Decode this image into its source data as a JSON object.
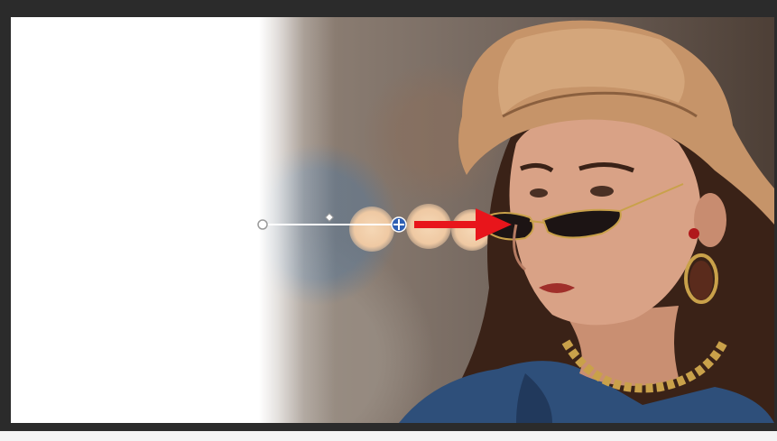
{
  "canvas": {
    "description_colors": {
      "frame": "#2b2b2b",
      "canvas_left": "#ffffff",
      "arrow": "#e8151b",
      "handle_center": "#2f5fb3"
    }
  },
  "gradient_tool": {
    "start_handle_icon": "circle-handle-icon",
    "midpoint_icon": "diamond-midpoint-icon",
    "center_handle_icon": "move-crosshair-icon"
  },
  "annotation": {
    "arrow_icon": "red-arrow-icon"
  }
}
